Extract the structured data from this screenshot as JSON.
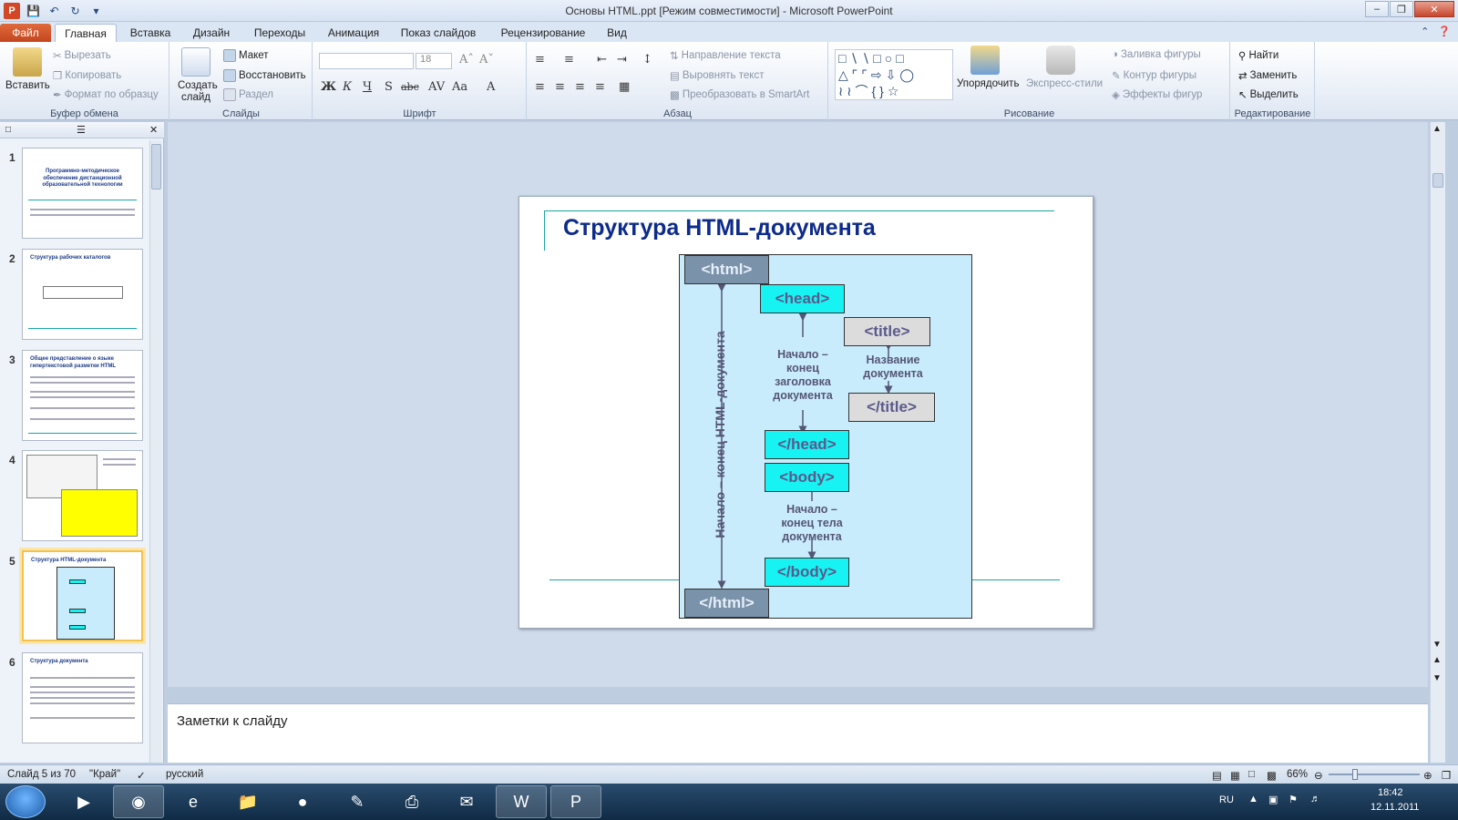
{
  "window": {
    "title": "Основы HTML.ppt [Режим совместимости]  -  Microsoft PowerPoint",
    "app_logo": "P"
  },
  "tabs": {
    "file": "Файл",
    "items": [
      "Главная",
      "Вставка",
      "Дизайн",
      "Переходы",
      "Анимация",
      "Показ слайдов",
      "Рецензирование",
      "Вид"
    ]
  },
  "ribbon": {
    "clipboard": {
      "paste": "Вставить",
      "cut": "Вырезать",
      "copy": "Копировать",
      "format_painter": "Формат по образцу",
      "label": "Буфер обмена"
    },
    "slides": {
      "new_slide_line1": "Создать",
      "new_slide_line2": "слайд",
      "layout": "Макет",
      "reset": "Восстановить",
      "section": "Раздел",
      "label": "Слайды"
    },
    "font": {
      "size": "18",
      "label": "Шрифт",
      "bold": "Ж",
      "italic": "К",
      "underline": "Ч",
      "strike": "abc"
    },
    "paragraph": {
      "text_direction": "Направление текста",
      "align_text": "Выровнять текст",
      "smartart": "Преобразовать в SmartArt",
      "label": "Абзац"
    },
    "drawing": {
      "arrange": "Упорядочить",
      "quick_styles": "Экспресс-стили",
      "fill": "Заливка фигуры",
      "outline": "Контур фигуры",
      "effects": "Эффекты фигур",
      "label": "Рисование"
    },
    "editing": {
      "find": "Найти",
      "replace": "Заменить",
      "select": "Выделить",
      "label": "Редактирование"
    }
  },
  "thumbnails": [
    {
      "num": "1",
      "title": "Программно-методическое обеспечение дистанционной образовательной технологии"
    },
    {
      "num": "2",
      "title": "Структура рабочих каталогов"
    },
    {
      "num": "3",
      "title": "Общее представление о языке гипертекстовой разметки HTML"
    },
    {
      "num": "4",
      "title": ""
    },
    {
      "num": "5",
      "title": "Структура HTML-документа"
    },
    {
      "num": "6",
      "title": "Структура документа"
    }
  ],
  "slide": {
    "title": "Структура HTML-документа",
    "tags": {
      "html_open": "<html>",
      "head_open": "<head>",
      "title_open": "<title>",
      "title_close": "</title>",
      "head_close": "</head>",
      "body_open": "<body>",
      "body_close": "</body>",
      "html_close": "</html>"
    },
    "labels": {
      "doc_span": "Начало – конец HTML-документа",
      "head_span": "Начало – конец заголовка документа",
      "title_span": "Название документа",
      "body_span": "Начало – конец тела документа"
    }
  },
  "notes": {
    "placeholder": "Заметки к слайду"
  },
  "status": {
    "slide_counter": "Слайд 5 из 70",
    "theme": "\"Край\"",
    "language": "русский",
    "zoom": "66%"
  },
  "tray": {
    "lang": "RU",
    "time": "18:42",
    "date": "12.11.2011"
  }
}
